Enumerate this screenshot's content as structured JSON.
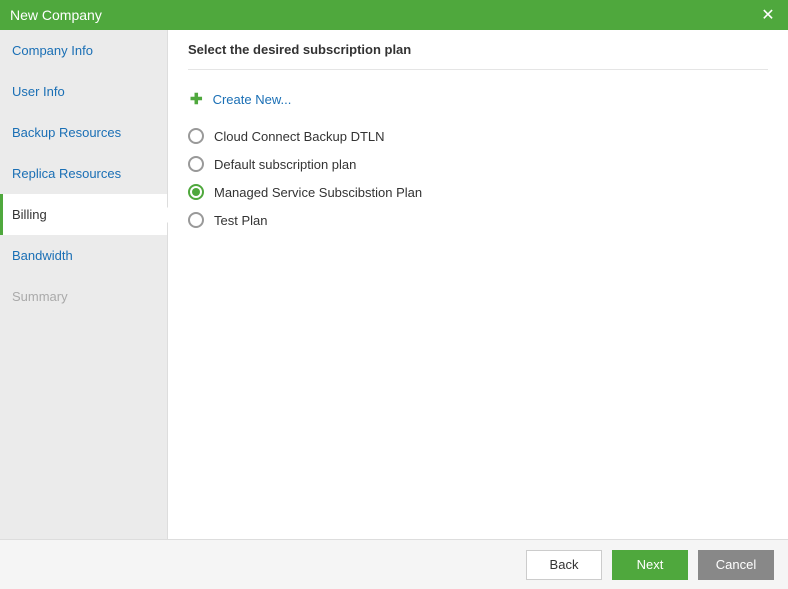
{
  "titlebar": {
    "title": "New Company"
  },
  "sidebar": {
    "items": [
      {
        "label": "Company Info",
        "state": "link"
      },
      {
        "label": "User Info",
        "state": "link"
      },
      {
        "label": "Backup Resources",
        "state": "link"
      },
      {
        "label": "Replica Resources",
        "state": "link"
      },
      {
        "label": "Billing",
        "state": "active"
      },
      {
        "label": "Bandwidth",
        "state": "link"
      },
      {
        "label": "Summary",
        "state": "disabled"
      }
    ]
  },
  "main": {
    "heading": "Select the desired subscription plan",
    "create_new_label": "Create New...",
    "plans": [
      {
        "label": "Cloud Connect Backup DTLN",
        "selected": false
      },
      {
        "label": "Default subscription plan",
        "selected": false
      },
      {
        "label": "Managed Service Subscibstion Plan",
        "selected": true
      },
      {
        "label": "Test Plan",
        "selected": false
      }
    ]
  },
  "footer": {
    "back_label": "Back",
    "next_label": "Next",
    "cancel_label": "Cancel"
  }
}
